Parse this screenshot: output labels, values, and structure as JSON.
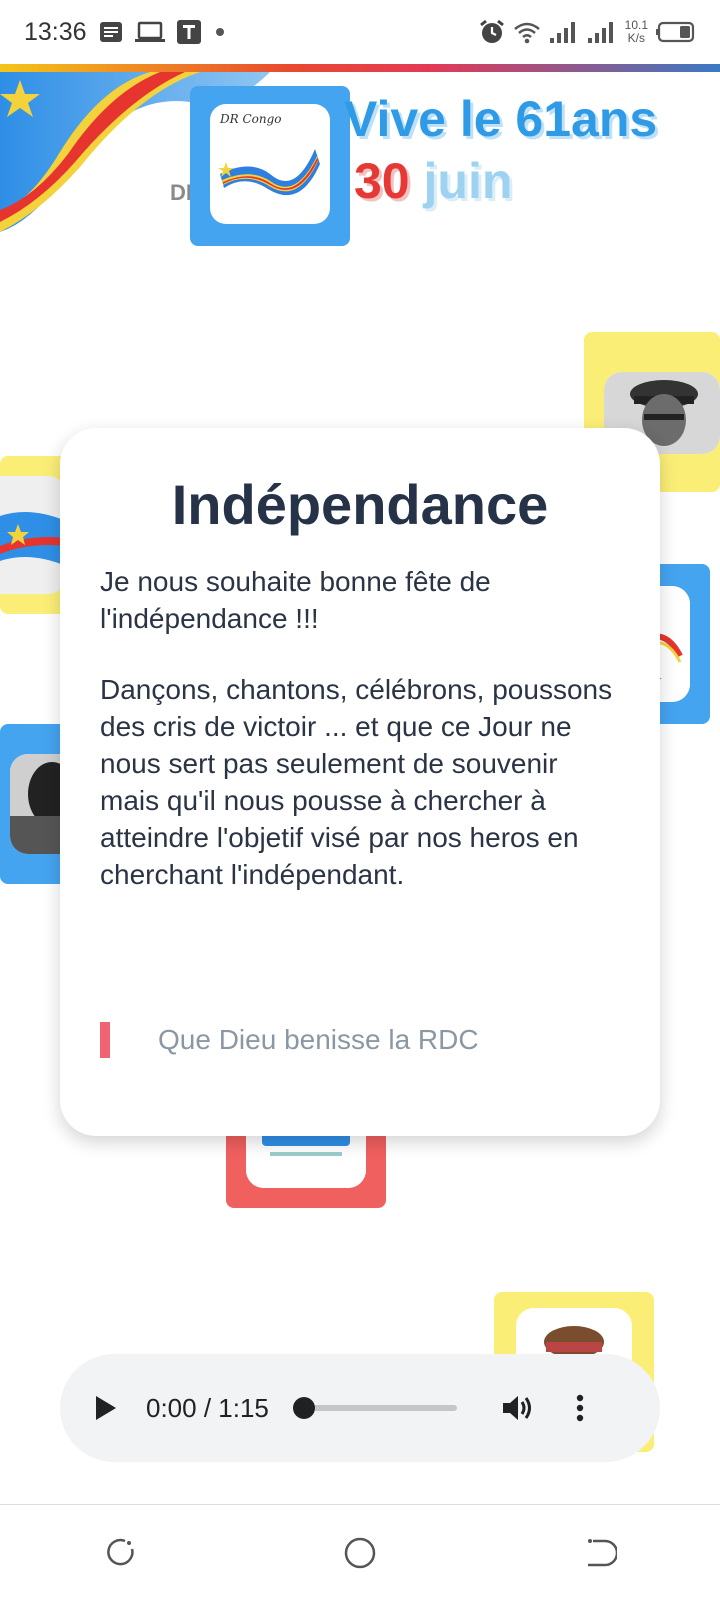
{
  "status_bar": {
    "time": "13:36",
    "speed_value": "10.1",
    "speed_unit": "K/s",
    "icons": [
      "notes-icon",
      "laptop-icon",
      "t-app-icon",
      "dot-icon",
      "alarm-icon",
      "wifi-icon",
      "signal-icon",
      "signal-icon",
      "battery-icon"
    ]
  },
  "header": {
    "logo_caption": "DR Congo",
    "dr_text": "DR",
    "headline_line1": "Vive le 61ans",
    "headline_line2_red": "30",
    "headline_line2_blue": " juin"
  },
  "card": {
    "title": "Indépendance",
    "paragraph1": "Je nous souhaite bonne fête de l'indépendance !!!",
    "paragraph2": "Dançons, chantons, célébrons, poussons des cris de victoir ... et que ce Jour ne nous sert pas seulement de souvenir mais qu'il nous pousse à chercher à atteindre l'objetif visé par nos heros en cherchant l'indépendant.",
    "quote": "Que Dieu benisse la RDC"
  },
  "audio": {
    "time_display": "0:00 / 1:15",
    "progress": 0
  },
  "colors": {
    "blue_tile": "#45a4f0",
    "yellow_tile": "#fbee77",
    "red_tile": "#f0605f",
    "quote_accent": "#ef6372"
  }
}
